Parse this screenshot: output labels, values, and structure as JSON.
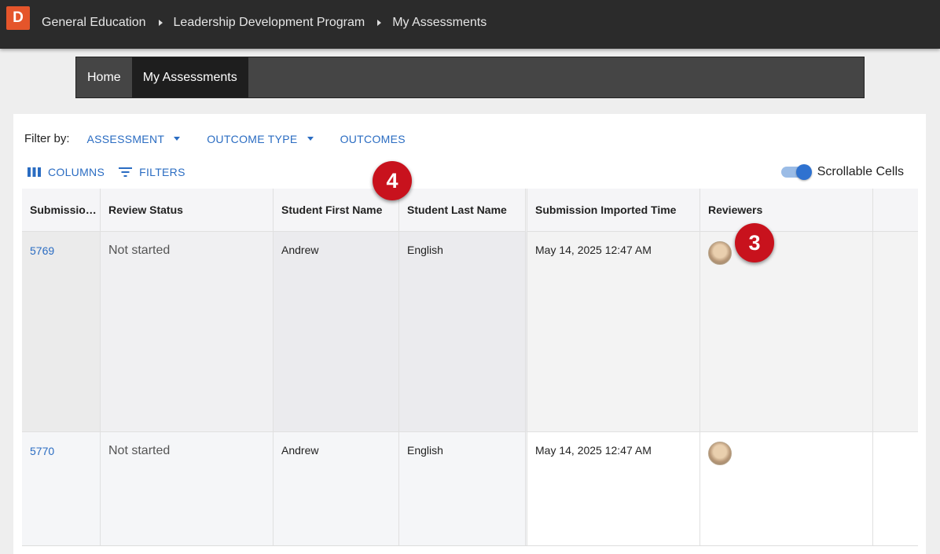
{
  "app": {
    "logo_letter": "D"
  },
  "breadcrumbs": [
    "General Education",
    "Leadership Development Program",
    "My Assessments"
  ],
  "nav": {
    "tabs": [
      "Home",
      "My Assessments"
    ],
    "active": "My Assessments"
  },
  "filters": {
    "label": "Filter by:",
    "items": [
      "ASSESSMENT",
      "OUTCOME TYPE",
      "OUTCOMES"
    ]
  },
  "toolbar": {
    "columns_label": "COLUMNS",
    "filters_label": "FILTERS"
  },
  "scrollable": {
    "label": "Scrollable Cells",
    "enabled": true
  },
  "table": {
    "columns": [
      "Submission ID",
      "Review Status",
      "Student First Name",
      "Student Last Name",
      "Submission Imported Time",
      "Reviewers"
    ],
    "rows": [
      {
        "id": "5769",
        "status": "Not started",
        "first": "Andrew",
        "last": "English",
        "time": "May 14, 2025 12:47 AM",
        "reviewer_icon": "reviewer-avatar"
      },
      {
        "id": "5770",
        "status": "Not started",
        "first": "Andrew",
        "last": "English",
        "time": "May 14, 2025 12:47 AM",
        "reviewer_icon": "reviewer-avatar"
      }
    ]
  },
  "callouts": [
    "4",
    "3"
  ],
  "colors": {
    "accent": "#2a6cc2",
    "topbar": "#2b2b2b",
    "logo": "#e5552b",
    "callout": "#c8121d",
    "toggle": "#2f72d0"
  }
}
